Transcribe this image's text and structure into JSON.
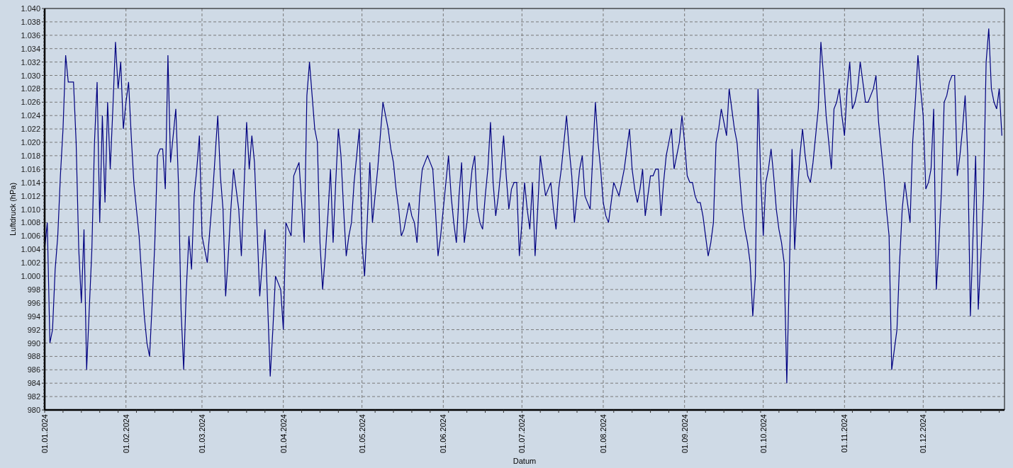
{
  "chart": {
    "chart_data": {
      "type": "line",
      "grid": true,
      "xlabel": "Datum",
      "ylabel": "Luftdruck (hPa)",
      "ylim": [
        980,
        1040
      ],
      "yticks": [
        980,
        982,
        984,
        986,
        988,
        990,
        992,
        994,
        996,
        998,
        {
          "value": 1000,
          "label": "1.000"
        },
        {
          "value": 1002,
          "label": "1.002"
        },
        {
          "value": 1004,
          "label": "1.004"
        },
        {
          "value": 1006,
          "label": "1.006"
        },
        {
          "value": 1008,
          "label": "1.008"
        },
        {
          "value": 1010,
          "label": "1.010"
        },
        {
          "value": 1012,
          "label": "1.012"
        },
        {
          "value": 1014,
          "label": "1.014"
        },
        {
          "value": 1016,
          "label": "1.016"
        },
        {
          "value": 1018,
          "label": "1.018"
        },
        {
          "value": 1020,
          "label": "1.020"
        },
        {
          "value": 1022,
          "label": "1.022"
        },
        {
          "value": 1024,
          "label": "1.024"
        },
        {
          "value": 1026,
          "label": "1.026"
        },
        {
          "value": 1028,
          "label": "1.028"
        },
        {
          "value": 1030,
          "label": "1.030"
        },
        {
          "value": 1032,
          "label": "1.032"
        },
        {
          "value": 1034,
          "label": "1.034"
        },
        {
          "value": 1036,
          "label": "1.036"
        },
        {
          "value": 1038,
          "label": "1.038"
        },
        {
          "value": 1040,
          "label": "1.040"
        }
      ],
      "categories": [
        "01.01.2024",
        null,
        null,
        null,
        null,
        null,
        null,
        null,
        null,
        null,
        null,
        null,
        null,
        null,
        null,
        null,
        null,
        null,
        null,
        null,
        null,
        null,
        null,
        null,
        null,
        null,
        null,
        null,
        null,
        null,
        null,
        "01.02.2024",
        null,
        null,
        null,
        null,
        null,
        null,
        null,
        null,
        null,
        null,
        null,
        null,
        null,
        null,
        null,
        null,
        null,
        null,
        null,
        null,
        null,
        null,
        null,
        null,
        null,
        null,
        null,
        null,
        "01.03.2024",
        null,
        null,
        null,
        null,
        null,
        null,
        null,
        null,
        null,
        null,
        null,
        null,
        null,
        null,
        null,
        null,
        null,
        null,
        null,
        null,
        null,
        null,
        null,
        null,
        null,
        null,
        null,
        null,
        null,
        null,
        "01.04.2024",
        null,
        null,
        null,
        null,
        null,
        null,
        null,
        null,
        null,
        null,
        null,
        null,
        null,
        null,
        null,
        null,
        null,
        null,
        null,
        null,
        null,
        null,
        null,
        null,
        null,
        null,
        null,
        null,
        null,
        "01.05.2024",
        null,
        null,
        null,
        null,
        null,
        null,
        null,
        null,
        null,
        null,
        null,
        null,
        null,
        null,
        null,
        null,
        null,
        null,
        null,
        null,
        null,
        null,
        null,
        null,
        null,
        null,
        null,
        null,
        null,
        null,
        "01.06.2024",
        null,
        null,
        null,
        null,
        null,
        null,
        null,
        null,
        null,
        null,
        null,
        null,
        null,
        null,
        null,
        null,
        null,
        null,
        null,
        null,
        null,
        null,
        null,
        null,
        null,
        null,
        null,
        null,
        null,
        "01.07.2024",
        null,
        null,
        null,
        null,
        null,
        null,
        null,
        null,
        null,
        null,
        null,
        null,
        null,
        null,
        null,
        null,
        null,
        null,
        null,
        null,
        null,
        null,
        null,
        null,
        null,
        null,
        null,
        null,
        null,
        null,
        "01.08.2024",
        null,
        null,
        null,
        null,
        null,
        null,
        null,
        null,
        null,
        null,
        null,
        null,
        null,
        null,
        null,
        null,
        null,
        null,
        null,
        null,
        null,
        null,
        null,
        null,
        null,
        null,
        null,
        null,
        null,
        null,
        "01.09.2024",
        null,
        null,
        null,
        null,
        null,
        null,
        null,
        null,
        null,
        null,
        null,
        null,
        null,
        null,
        null,
        null,
        null,
        null,
        null,
        null,
        null,
        null,
        null,
        null,
        null,
        null,
        null,
        null,
        null,
        "01.10.2024",
        null,
        null,
        null,
        null,
        null,
        null,
        null,
        null,
        null,
        null,
        null,
        null,
        null,
        null,
        null,
        null,
        null,
        null,
        null,
        null,
        null,
        null,
        null,
        null,
        null,
        null,
        null,
        null,
        null,
        null,
        "01.11.2024",
        null,
        null,
        null,
        null,
        null,
        null,
        null,
        null,
        null,
        null,
        null,
        null,
        null,
        null,
        null,
        null,
        null,
        null,
        null,
        null,
        null,
        null,
        null,
        null,
        null,
        null,
        null,
        null,
        null,
        "01.12.2024",
        null,
        null,
        null,
        null,
        null,
        null,
        null,
        null,
        null,
        null,
        null,
        null,
        null,
        null,
        null,
        null,
        null,
        null,
        null,
        null,
        null,
        null,
        null,
        null,
        null,
        null,
        null,
        null,
        null,
        null
      ],
      "series": [
        {
          "color": "#000080",
          "values": [
            1004,
            1008,
            990,
            992,
            1001,
            1006,
            1015,
            1022,
            1033,
            1029,
            1029,
            1029,
            1020,
            1004,
            996,
            1007,
            986,
            995,
            1004,
            1020,
            1029,
            1008,
            1024,
            1011,
            1026,
            1016,
            1025,
            1035,
            1028,
            1032,
            1022,
            1026,
            1029,
            1021,
            1014,
            1010,
            1006,
            1000,
            994,
            990,
            988,
            996,
            1005,
            1018,
            1019,
            1019,
            1013,
            1033,
            1017,
            1021,
            1025,
            1014,
            995,
            986,
            998,
            1006,
            1001,
            1012,
            1016,
            1021,
            1006,
            1004,
            1002,
            1007,
            1012,
            1018,
            1024,
            1015,
            1010,
            997,
            1003,
            1010,
            1016,
            1013,
            1010,
            1003,
            1013,
            1023,
            1016,
            1021,
            1017,
            1007,
            997,
            1002,
            1007,
            996,
            985,
            992,
            1000,
            999,
            998,
            992,
            1008,
            1007,
            1006,
            1015,
            1016,
            1017,
            1011,
            1005,
            1027,
            1032,
            1027,
            1022,
            1020,
            1005,
            998,
            1003,
            1009,
            1016,
            1005,
            1014,
            1022,
            1018,
            1010,
            1003,
            1006,
            1008,
            1014,
            1018,
            1022,
            1005,
            1000,
            1008,
            1017,
            1008,
            1012,
            1016,
            1021,
            1026,
            1024,
            1022,
            1019,
            1017,
            1013,
            1010,
            1006,
            1007,
            1009,
            1011,
            1009,
            1008,
            1005,
            1012,
            1016,
            1017,
            1018,
            1017,
            1016,
            1010,
            1003,
            1006,
            1010,
            1014,
            1018,
            1012,
            1008,
            1005,
            1012,
            1017,
            1005,
            1008,
            1012,
            1016,
            1018,
            1010,
            1008,
            1007,
            1012,
            1016,
            1023,
            1014,
            1009,
            1012,
            1016,
            1021,
            1015,
            1010,
            1013,
            1014,
            1014,
            1003,
            1008,
            1014,
            1010,
            1007,
            1014,
            1003,
            1010,
            1018,
            1015,
            1012,
            1013,
            1014,
            1010,
            1007,
            1013,
            1016,
            1020,
            1024,
            1019,
            1015,
            1008,
            1012,
            1016,
            1018,
            1012,
            1011,
            1010,
            1018,
            1026,
            1020,
            1016,
            1011,
            1009,
            1008,
            1011,
            1014,
            1013,
            1012,
            1014,
            1016,
            1019,
            1022,
            1016,
            1013,
            1011,
            1013,
            1016,
            1009,
            1012,
            1015,
            1015,
            1016,
            1016,
            1009,
            1014,
            1018,
            1020,
            1022,
            1016,
            1018,
            1020,
            1024,
            1020,
            1015,
            1014,
            1014,
            1012,
            1011,
            1011,
            1009,
            1006,
            1003,
            1005,
            1008,
            1020,
            1022,
            1025,
            1023,
            1021,
            1028,
            1025,
            1022,
            1020,
            1015,
            1010,
            1007,
            1005,
            1002,
            994,
            1000,
            1028,
            1015,
            1006,
            1014,
            1016,
            1019,
            1015,
            1010,
            1007,
            1005,
            1002,
            984,
            1001,
            1019,
            1004,
            1012,
            1018,
            1022,
            1018,
            1015,
            1014,
            1017,
            1021,
            1025,
            1035,
            1030,
            1024,
            1020,
            1016,
            1025,
            1026,
            1028,
            1024,
            1021,
            1028,
            1032,
            1025,
            1026,
            1028,
            1032,
            1029,
            1026,
            1026,
            1027,
            1028,
            1030,
            1023,
            1019,
            1015,
            1010,
            1006,
            986,
            989,
            992,
            1002,
            1010,
            1014,
            1011,
            1008,
            1020,
            1026,
            1033,
            1028,
            1024,
            1013,
            1014,
            1016,
            1025,
            998,
            1005,
            1013,
            1026,
            1027,
            1029,
            1030,
            1030,
            1015,
            1018,
            1022,
            1027,
            1018,
            994,
            1006,
            1018,
            995,
            1003,
            1012,
            1032,
            1037,
            1028,
            1026,
            1025,
            1028,
            1021
          ]
        }
      ]
    }
  }
}
